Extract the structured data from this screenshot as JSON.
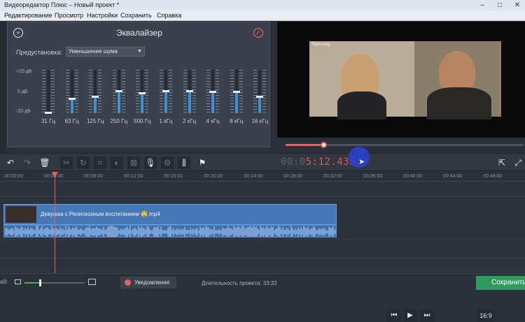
{
  "window": {
    "title": "Видеоредактор Плюс – Новый проект *"
  },
  "menu": [
    "Редактирование",
    "Просмотр",
    "Настройки",
    "Сохранить",
    "Справка"
  ],
  "equalizer": {
    "title": "Эквалайзер",
    "preset_label": "Предустановка:",
    "preset_value": "Уменьшение шума",
    "db_top": "+20 дБ",
    "db_mid": "0 дБ",
    "db_bottom": "-20 дБ",
    "bands": [
      {
        "label": "31 Гц",
        "level": 0.0
      },
      {
        "label": "63 Гц",
        "level": 0.32
      },
      {
        "label": "125 Гц",
        "level": 0.37
      },
      {
        "label": "250 Гц",
        "level": 0.5
      },
      {
        "label": "500 Гц",
        "level": 0.45
      },
      {
        "label": "1 кГц",
        "level": 0.5
      },
      {
        "label": "2 кГц",
        "level": 0.5
      },
      {
        "label": "4 кГц",
        "level": 0.48
      },
      {
        "label": "8 кГц",
        "level": 0.48
      },
      {
        "label": "16 кГц",
        "level": 0.37
      }
    ]
  },
  "preview": {
    "watermark": "Samsung"
  },
  "player": {
    "timecode_dim": "00:0",
    "timecode_main": "5:12.438",
    "progress": 0.16,
    "aspect": "16:9"
  },
  "ruler": [
    "00:00:00",
    "00:04:00",
    "00:08:00",
    "00:12:00",
    "00:16:00",
    "00:20:00",
    "00:24:00",
    "00:28:00",
    "00:32:00",
    "00:36:00",
    "00:40:00",
    "00:44:00",
    "00:48:00"
  ],
  "clip": {
    "title": "Девушка с Религиозным воспитанием 😲.mp4"
  },
  "status": {
    "scale_label": "аб:",
    "zoom": 0.25,
    "notifications": "Уведомления",
    "duration": "Длительность проекта:  33:32",
    "save": "Сохранить"
  }
}
